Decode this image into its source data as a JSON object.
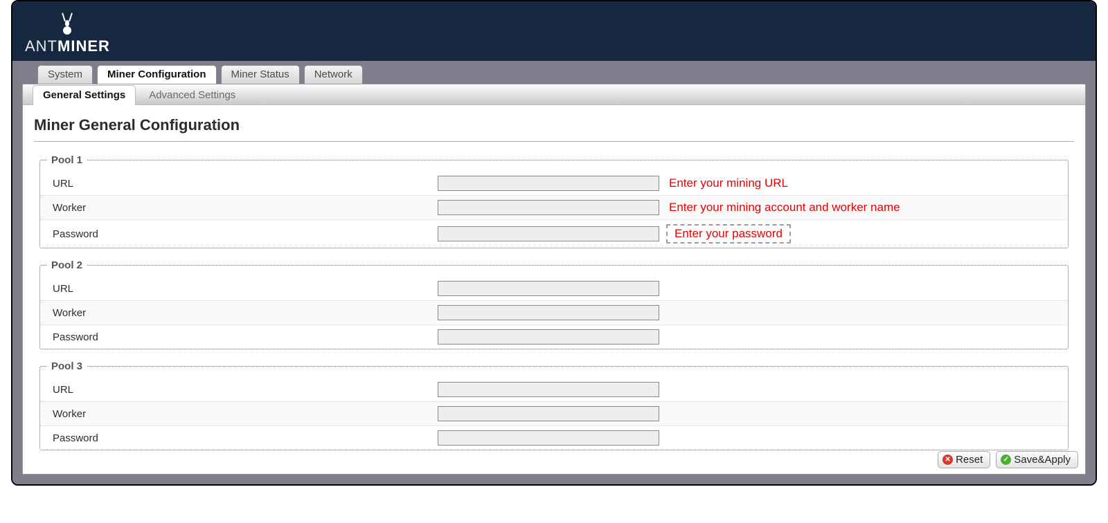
{
  "brand": {
    "light": "ANT",
    "bold": "MINER"
  },
  "topTabs": {
    "system": "System",
    "minerConfig": "Miner Configuration",
    "minerStatus": "Miner Status",
    "network": "Network"
  },
  "subTabs": {
    "general": "General Settings",
    "advanced": "Advanced Settings"
  },
  "pageTitle": "Miner General Configuration",
  "labels": {
    "url": "URL",
    "worker": "Worker",
    "password": "Password"
  },
  "pools": {
    "p1": {
      "legend": "Pool 1",
      "url": "",
      "worker": "",
      "password": "",
      "hintUrl": "Enter your mining URL",
      "hintWorker": "Enter your mining account and worker name",
      "hintPassword": "Enter your password"
    },
    "p2": {
      "legend": "Pool 2",
      "url": "",
      "worker": "",
      "password": ""
    },
    "p3": {
      "legend": "Pool 3",
      "url": "",
      "worker": "",
      "password": ""
    }
  },
  "buttons": {
    "reset": "Reset",
    "saveApply": "Save&Apply"
  }
}
